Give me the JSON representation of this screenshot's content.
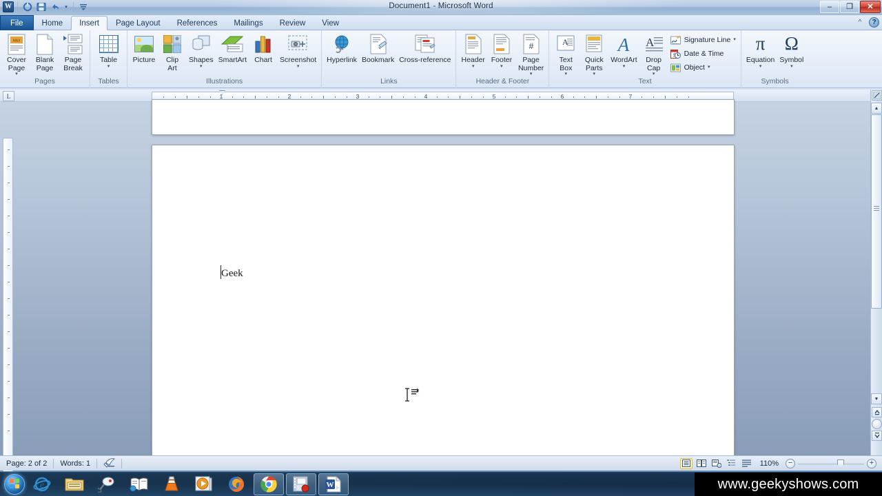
{
  "window": {
    "title": "Document1  -  Microsoft Word",
    "minimize_label": "–",
    "maximize_label": "❐",
    "close_label": "✕"
  },
  "quick_access": {
    "app_logo": "W",
    "items": [
      {
        "name": "undo-circle-icon",
        "label": "↺"
      },
      {
        "name": "save-icon",
        "label": "save"
      },
      {
        "name": "undo-icon",
        "label": "↶"
      },
      {
        "name": "customize-qat-icon",
        "label": "▾"
      }
    ]
  },
  "tabs": {
    "items": [
      {
        "id": "file",
        "label": "File"
      },
      {
        "id": "home",
        "label": "Home"
      },
      {
        "id": "insert",
        "label": "Insert"
      },
      {
        "id": "page-layout",
        "label": "Page Layout"
      },
      {
        "id": "references",
        "label": "References"
      },
      {
        "id": "mailings",
        "label": "Mailings"
      },
      {
        "id": "review",
        "label": "Review"
      },
      {
        "id": "view",
        "label": "View"
      }
    ],
    "active": "Insert",
    "minimize_ribbon_icon": "^",
    "help_icon": "?"
  },
  "ribbon": {
    "groups": [
      {
        "name": "pages",
        "label": "Pages",
        "buttons": [
          {
            "name": "cover-page-button",
            "label": "Cover\nPage",
            "caret": "▾"
          },
          {
            "name": "blank-page-button",
            "label": "Blank\nPage",
            "caret": ""
          },
          {
            "name": "page-break-button",
            "label": "Page\nBreak",
            "caret": ""
          }
        ]
      },
      {
        "name": "tables",
        "label": "Tables",
        "buttons": [
          {
            "name": "table-button",
            "label": "Table",
            "caret": "▾"
          }
        ]
      },
      {
        "name": "illustrations",
        "label": "Illustrations",
        "buttons": [
          {
            "name": "picture-button",
            "label": "Picture",
            "caret": ""
          },
          {
            "name": "clip-art-button",
            "label": "Clip\nArt",
            "caret": ""
          },
          {
            "name": "shapes-button",
            "label": "Shapes",
            "caret": "▾"
          },
          {
            "name": "smartart-button",
            "label": "SmartArt",
            "caret": ""
          },
          {
            "name": "chart-button",
            "label": "Chart",
            "caret": ""
          },
          {
            "name": "screenshot-button",
            "label": "Screenshot",
            "caret": "▾"
          }
        ]
      },
      {
        "name": "links",
        "label": "Links",
        "buttons": [
          {
            "name": "hyperlink-button",
            "label": "Hyperlink",
            "caret": ""
          },
          {
            "name": "bookmark-button",
            "label": "Bookmark",
            "caret": ""
          },
          {
            "name": "cross-reference-button",
            "label": "Cross-reference",
            "caret": ""
          }
        ]
      },
      {
        "name": "header-footer",
        "label": "Header & Footer",
        "buttons": [
          {
            "name": "header-button",
            "label": "Header",
            "caret": "▾"
          },
          {
            "name": "footer-button",
            "label": "Footer",
            "caret": "▾"
          },
          {
            "name": "page-number-button",
            "label": "Page\nNumber",
            "caret": "▾"
          }
        ]
      },
      {
        "name": "text",
        "label": "Text",
        "buttons": [
          {
            "name": "text-box-button",
            "label": "Text\nBox",
            "caret": "▾"
          },
          {
            "name": "quick-parts-button",
            "label": "Quick\nParts",
            "caret": "▾"
          },
          {
            "name": "wordart-button",
            "label": "WordArt",
            "caret": "▾"
          },
          {
            "name": "drop-cap-button",
            "label": "Drop\nCap",
            "caret": "▾"
          }
        ],
        "small_buttons": [
          {
            "name": "signature-line-button",
            "label": "Signature Line",
            "caret": "▾"
          },
          {
            "name": "date-and-time-button",
            "label": "Date & Time",
            "caret": ""
          },
          {
            "name": "object-button",
            "label": "Object",
            "caret": "▾"
          }
        ]
      },
      {
        "name": "symbols",
        "label": "Symbols",
        "buttons": [
          {
            "name": "equation-button",
            "label": "Equation",
            "glyph": "π",
            "caret": "▾"
          },
          {
            "name": "symbol-button",
            "label": "Symbol",
            "glyph": "Ω",
            "caret": "▾"
          }
        ]
      }
    ]
  },
  "ruler": {
    "corner_tab_label": "L",
    "numbers": [
      "1",
      "2",
      "3",
      "4",
      "5",
      "6",
      "7"
    ]
  },
  "document": {
    "body_text": "Geek"
  },
  "status_bar": {
    "page": "Page: 2 of 2",
    "words": "Words: 1",
    "proofing_icon": "proofing-errors-icon",
    "zoom_level": "110%",
    "zoom_out_label": "−",
    "zoom_in_label": "+",
    "views": [
      {
        "name": "print-layout-view-button",
        "label": "▤",
        "selected": true
      },
      {
        "name": "full-screen-reading-view-button",
        "label": "▥",
        "selected": false
      },
      {
        "name": "web-layout-view-button",
        "label": "▦",
        "selected": false
      },
      {
        "name": "outline-view-button",
        "label": "▤",
        "selected": false
      },
      {
        "name": "draft-view-button",
        "label": "≡",
        "selected": false
      }
    ]
  },
  "taskbar": {
    "start_label": "Start",
    "items": [
      {
        "name": "taskbar-internet-explorer",
        "label": "e",
        "open": false
      },
      {
        "name": "taskbar-windows-explorer",
        "label": "folder",
        "open": false
      },
      {
        "name": "taskbar-paint-tool",
        "label": "paint",
        "open": false
      },
      {
        "name": "taskbar-dictionary",
        "label": "book",
        "open": false
      },
      {
        "name": "taskbar-vlc-player",
        "label": "vlc",
        "open": false
      },
      {
        "name": "taskbar-media-player",
        "label": "wmp",
        "open": false
      },
      {
        "name": "taskbar-firefox",
        "label": "firefox",
        "open": false
      },
      {
        "name": "taskbar-google-chrome",
        "label": "chrome",
        "open": true
      },
      {
        "name": "taskbar-video-recorder",
        "label": "recorder",
        "open": true
      },
      {
        "name": "taskbar-microsoft-word",
        "label": "W",
        "open": true
      }
    ],
    "watermark": "www.geekyshows.com"
  }
}
